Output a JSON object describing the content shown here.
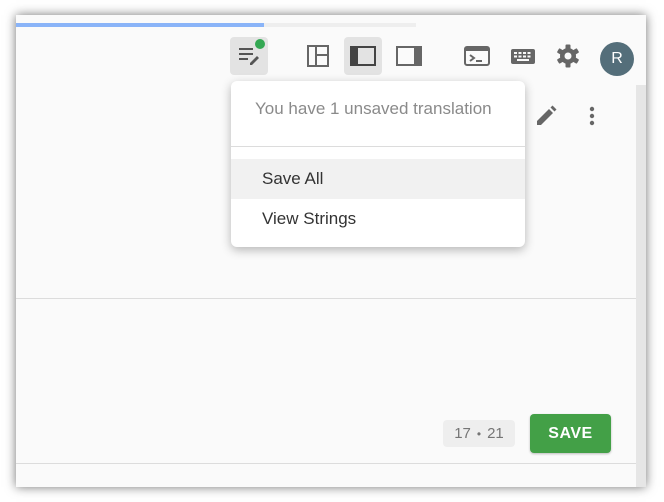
{
  "toolbar": {
    "progress_percent": 62,
    "avatar_initial": "R",
    "icons": [
      "edit-note-icon",
      "layout-grid-icon",
      "layout-sidebar-left-icon",
      "layout-sidebar-right-icon",
      "terminal-icon",
      "keyboard-icon",
      "gear-icon"
    ],
    "status_dot_color": "#34a853"
  },
  "menu": {
    "header": "You have 1 unsaved translation",
    "items": [
      {
        "label": "Save All"
      },
      {
        "label": "View Strings"
      }
    ]
  },
  "footer": {
    "counter_left": "17",
    "counter_sep": "•",
    "counter_right": "21",
    "save_label": "SAVE"
  },
  "colors": {
    "accent_green": "#43a047",
    "progress_blue": "#8ab4f8",
    "avatar_bg": "#546e7a"
  }
}
